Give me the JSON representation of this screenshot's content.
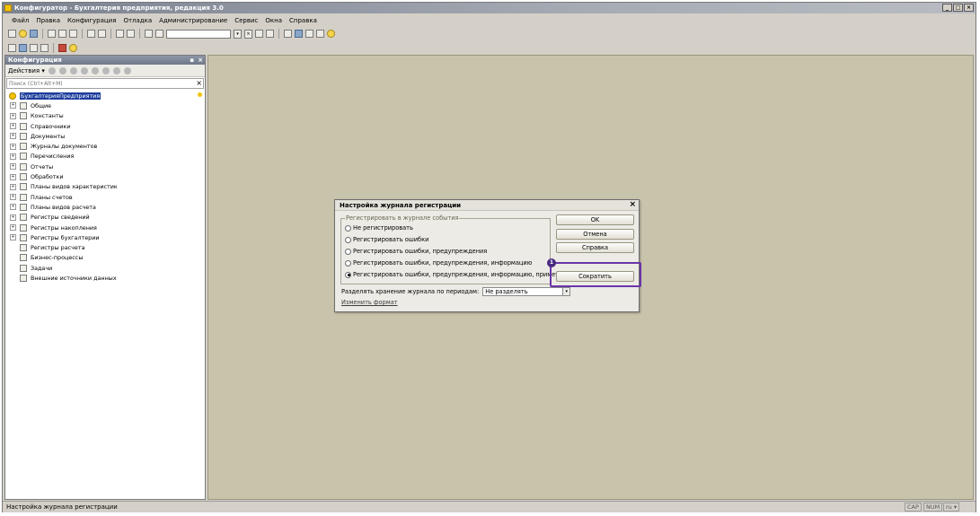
{
  "window": {
    "title": "Конфигуратор - Бухгалтерия предприятия, редакция 3.0",
    "controls": [
      "_",
      "□",
      "×"
    ]
  },
  "menu": [
    "Файл",
    "Правка",
    "Конфигурация",
    "Отладка",
    "Администрирование",
    "Сервис",
    "Окна",
    "Справка"
  ],
  "panel": {
    "title": "Конфигурация",
    "header_pin": "▪",
    "header_close": "×",
    "actions_label": "Действия ▾",
    "search_placeholder": "Поиск (Ctrl+Alt+M)",
    "search_clear": "×",
    "tree": [
      {
        "label": "БухгалтерияПредприятия",
        "root": true
      },
      {
        "label": "Общие",
        "expand": "+"
      },
      {
        "label": "Константы",
        "expand": "+"
      },
      {
        "label": "Справочники",
        "expand": "+"
      },
      {
        "label": "Документы",
        "expand": "+"
      },
      {
        "label": "Журналы документов",
        "expand": "+"
      },
      {
        "label": "Перечисления",
        "expand": "+"
      },
      {
        "label": "Отчеты",
        "expand": "+"
      },
      {
        "label": "Обработки",
        "expand": "+"
      },
      {
        "label": "Планы видов характеристик",
        "expand": "+"
      },
      {
        "label": "Планы счетов",
        "expand": "+"
      },
      {
        "label": "Планы видов расчета",
        "expand": "+"
      },
      {
        "label": "Регистры сведений",
        "expand": "+"
      },
      {
        "label": "Регистры накопления",
        "expand": "+"
      },
      {
        "label": "Регистры бухгалтерии",
        "expand": "+"
      },
      {
        "label": "Регистры расчета",
        "expand": ""
      },
      {
        "label": "Бизнес-процессы",
        "expand": ""
      },
      {
        "label": "Задачи",
        "expand": ""
      },
      {
        "label": "Внешние источники данных",
        "expand": ""
      }
    ]
  },
  "dialog": {
    "title": "Настройка журнала регистрации",
    "close": "×",
    "group_label": "Регистрировать в журнале события",
    "options": [
      {
        "label": "Не регистрировать",
        "selected": false
      },
      {
        "label": "Регистрировать ошибки",
        "selected": false
      },
      {
        "label": "Регистрировать ошибки, предупреждения",
        "selected": false
      },
      {
        "label": "Регистрировать ошибки, предупреждения, информацию",
        "selected": false
      },
      {
        "label": "Регистрировать ошибки, предупреждения, информацию, примечания",
        "selected": true
      }
    ],
    "buttons": {
      "ok": "OK",
      "cancel": "Отмена",
      "help": "Справка",
      "shrink": "Сократить"
    },
    "split_label": "Разделять хранение журнала по периодам:",
    "split_value": "Не разделять",
    "format_link": "Изменить формат"
  },
  "annotation": {
    "badge": "1",
    "color": "#6a35a8"
  },
  "status": {
    "text": "Настройка журнала регистрации",
    "cap": "CAP",
    "num": "NUM",
    "lang": "ru ▾"
  },
  "colors": {
    "workspace": "#c8c3ab",
    "selection": "#1c3d9c"
  }
}
